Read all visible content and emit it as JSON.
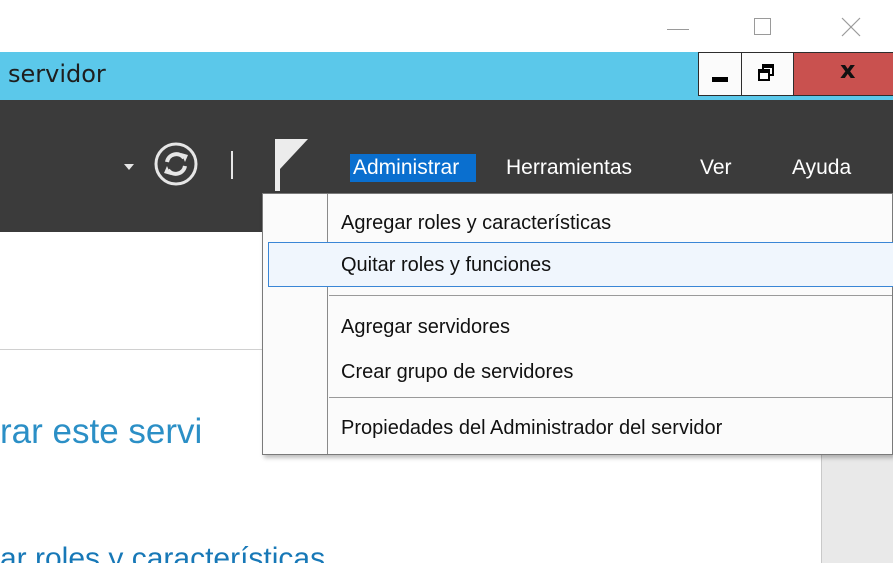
{
  "outer_window": {
    "controls": {
      "minimize": "minimize-icon",
      "maximize": "maximize-icon",
      "close": "close-icon"
    }
  },
  "window": {
    "title": "servidor",
    "close_label": "x"
  },
  "toolbar": {
    "refresh_icon": "refresh-icon",
    "flag_icon": "flag-icon"
  },
  "menubar": {
    "items": [
      {
        "label": "Administrar",
        "active": true
      },
      {
        "label": "Herramientas"
      },
      {
        "label": "Ver"
      },
      {
        "label": "Ayuda"
      }
    ]
  },
  "dropdown": {
    "items": [
      {
        "label": "Agregar roles y características"
      },
      {
        "label": "Quitar roles y funciones",
        "hovered": true
      },
      {
        "label": "Agregar servidores"
      },
      {
        "label": "Crear grupo de servidores"
      },
      {
        "label": "Propiedades del Administrador del servidor"
      }
    ]
  },
  "content": {
    "heading": "rar este servi",
    "subheading": "ar roles y características"
  },
  "colors": {
    "title_bar": "#5bc8ea",
    "toolbar": "#3b3b3b",
    "menu_highlight": "#0a6fcf",
    "close_button": "#c9514f",
    "heading_text": "#2b8fc6"
  }
}
